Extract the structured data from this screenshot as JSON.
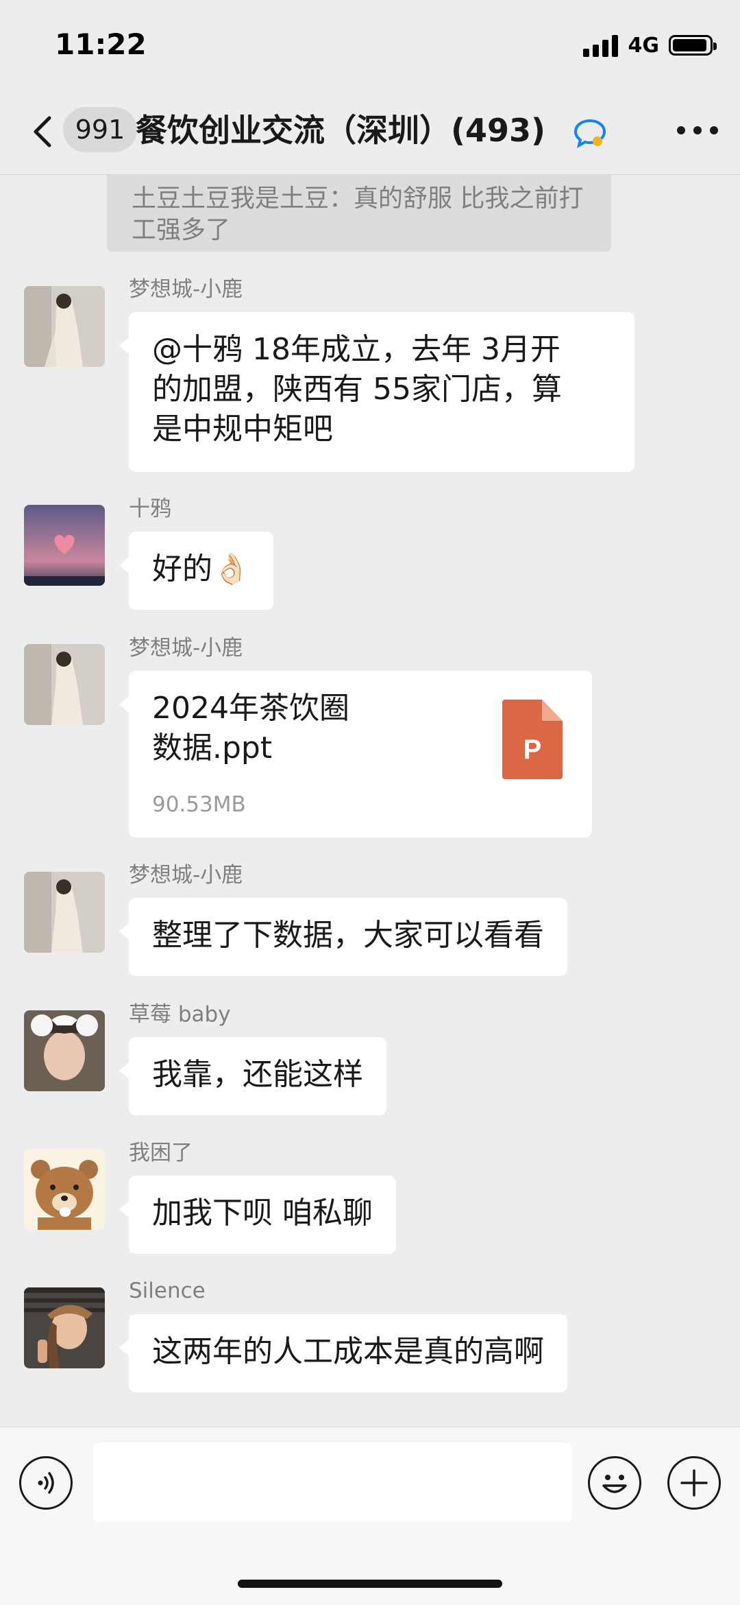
{
  "status_bar": {
    "time": "11:22",
    "network": "4G",
    "battery_level": 0.95,
    "icons": [
      "signal-icon",
      "battery-icon"
    ]
  },
  "header": {
    "unread_count": "991",
    "title": "餐饮创业交流（深圳）(493)",
    "icons": [
      "back-icon",
      "group-chat-icon",
      "more-icon"
    ]
  },
  "quoted_message": {
    "text": "土豆土豆我是土豆：真的舒服 比我之前打工强多了"
  },
  "messages": [
    {
      "sender": "梦想城-小鹿",
      "type": "text",
      "lines": [
        "@十鸦 18年成立，去年 3月开",
        "的加盟，陕西有 55家门店，算",
        "是中规中矩吧"
      ]
    },
    {
      "sender": "十鸦",
      "type": "text",
      "text": "好的",
      "emoji": "👌🏻"
    },
    {
      "sender": "梦想城-小鹿",
      "type": "file",
      "file_lines": [
        "2024年茶饮圈",
        "数据.ppt"
      ],
      "file_size": "90.53MB",
      "file_icon": "ppt-file-icon",
      "file_icon_letter": "P"
    },
    {
      "sender": "梦想城-小鹿",
      "type": "text",
      "text": "整理了下数据，大家可以看看"
    },
    {
      "sender": "草莓 baby",
      "type": "text",
      "text": "我靠，还能这样"
    },
    {
      "sender": "我困了",
      "type": "text",
      "text": "加我下呗 咱私聊"
    },
    {
      "sender": "Silence",
      "type": "text",
      "text": "这两年的人工成本是真的高啊"
    }
  ],
  "input_bar": {
    "input_value": "",
    "icons": [
      "voice-icon",
      "emoji-icon",
      "plus-icon"
    ]
  },
  "colors": {
    "background": "#ededed",
    "bubble": "#ffffff",
    "ppt_orange": "#dc6744",
    "link_blue": "#1485ee"
  }
}
